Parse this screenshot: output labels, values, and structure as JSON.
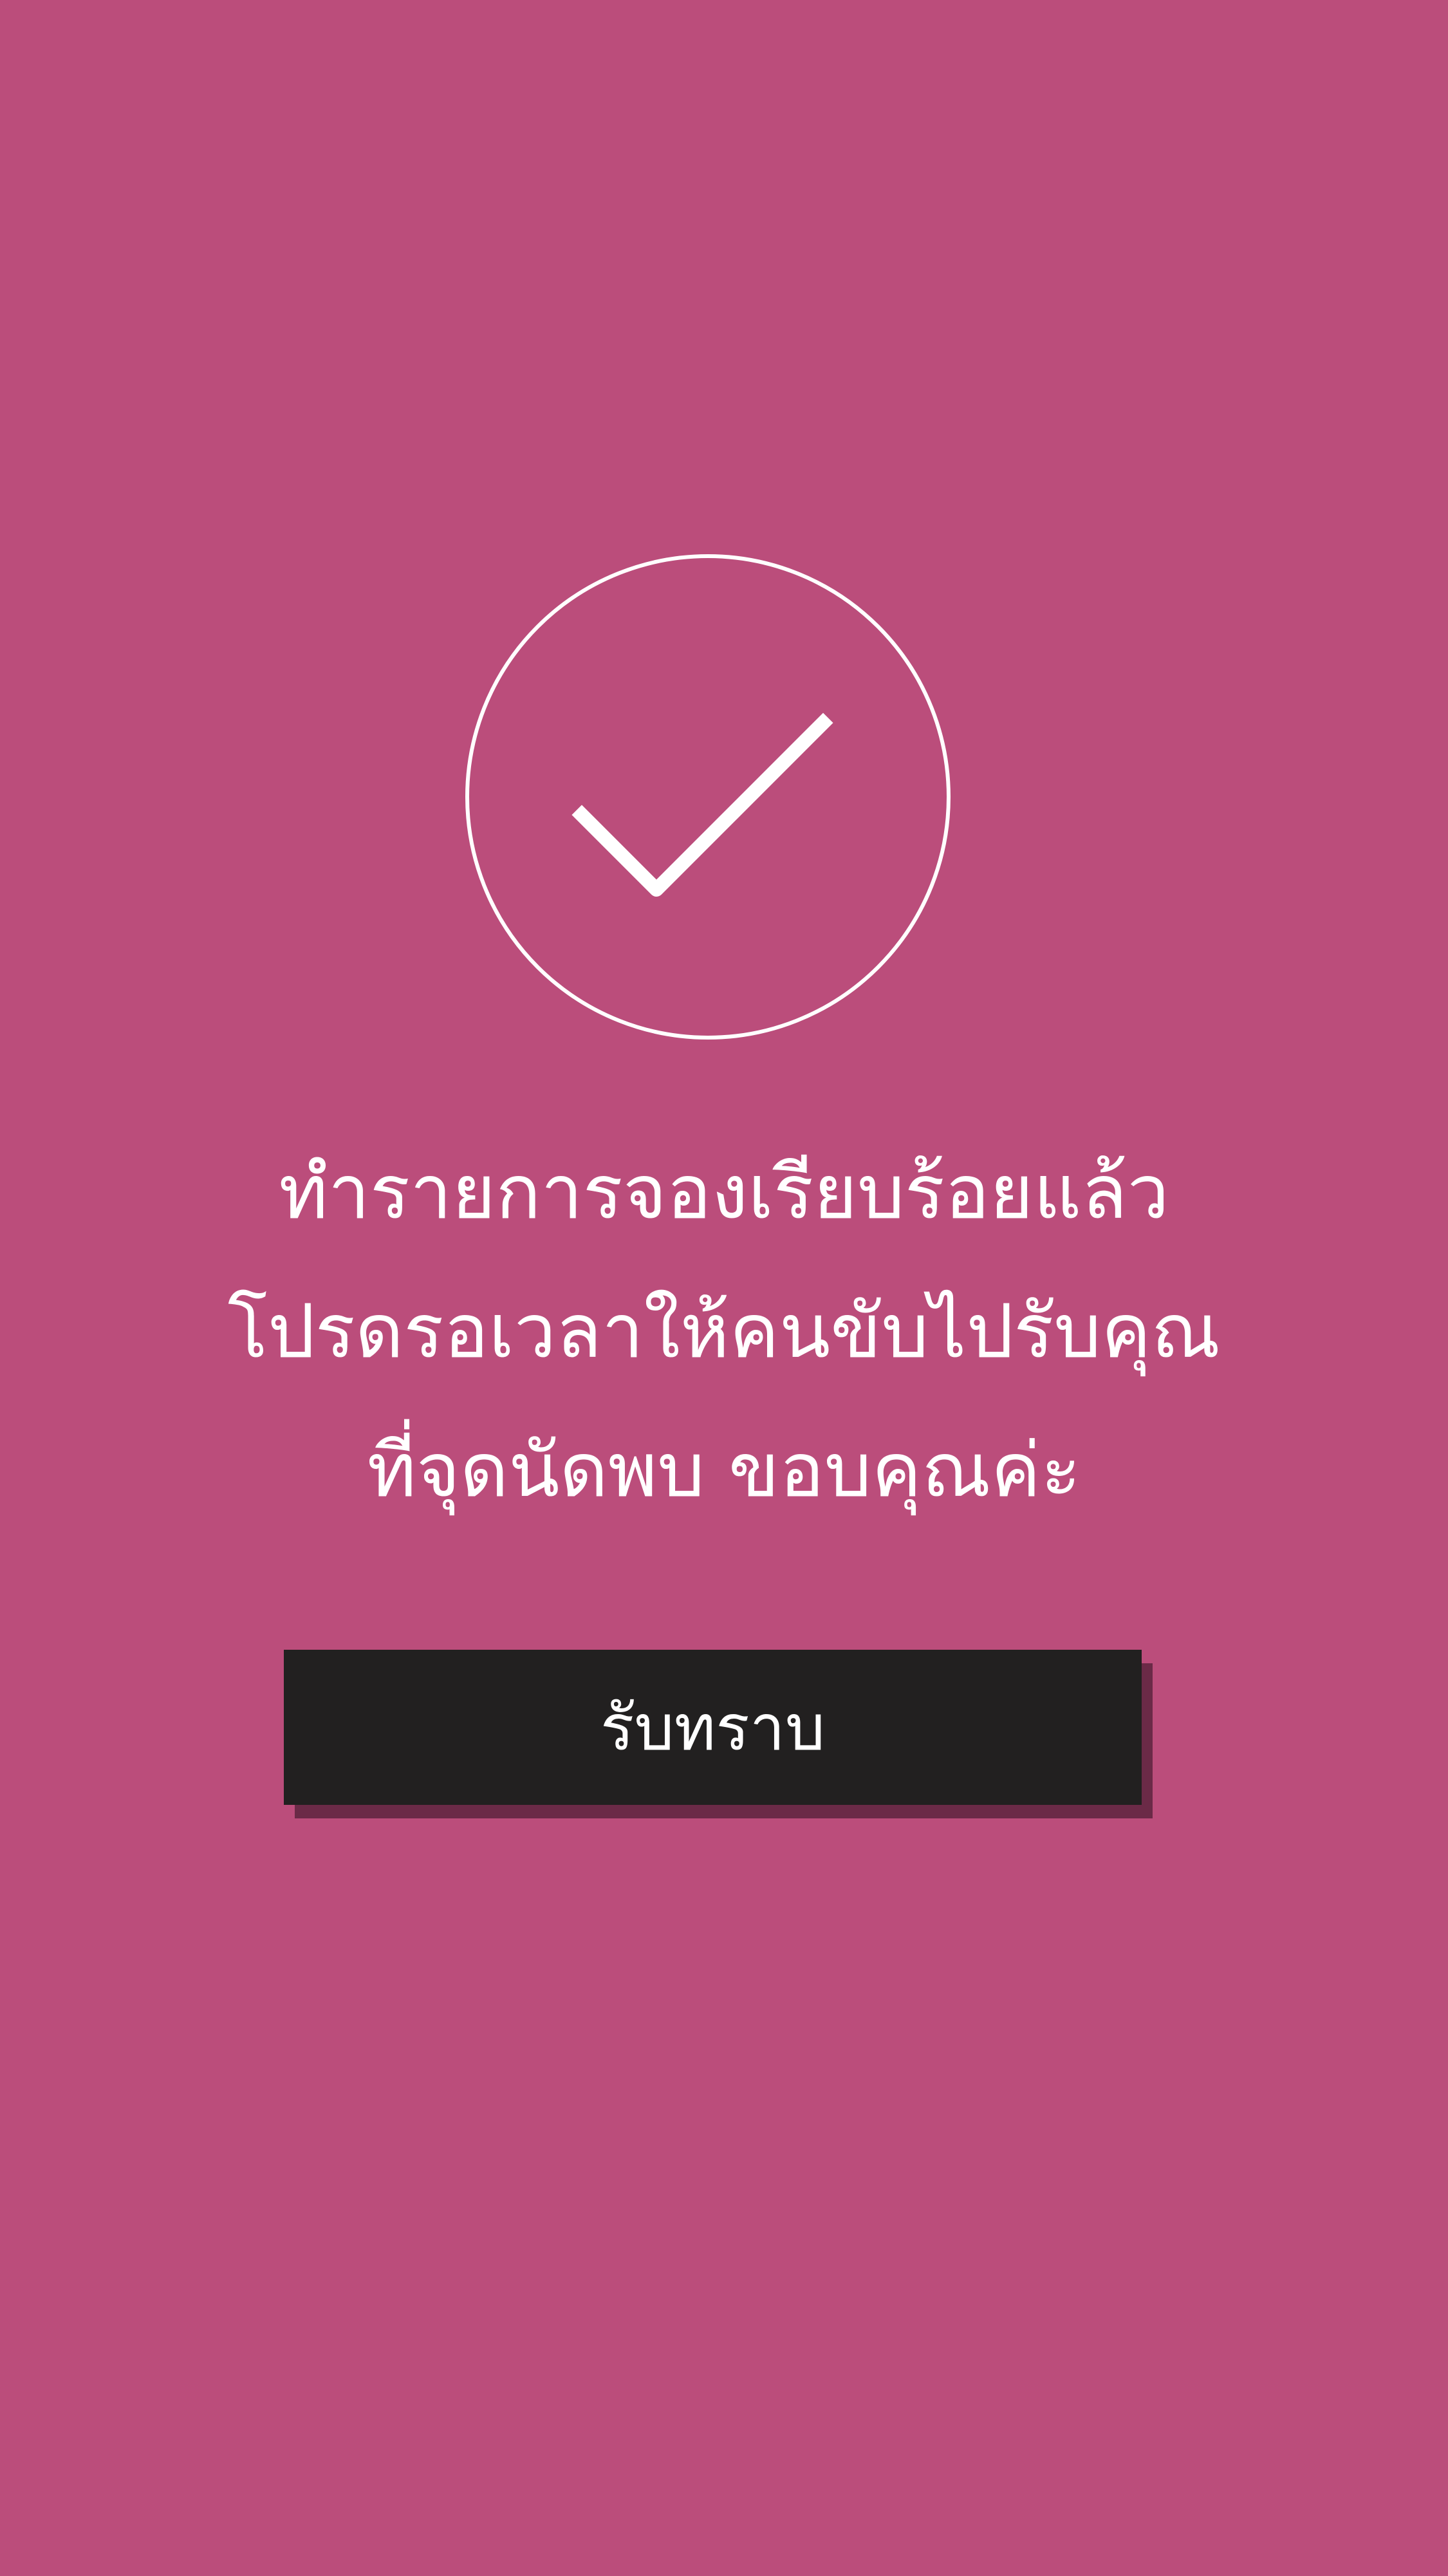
{
  "icons": {
    "success": "check-circle-icon"
  },
  "colors": {
    "background": "#bb4d7b",
    "button": "#222020",
    "button_shadow": "#6b2a47",
    "text": "#ffffff"
  },
  "message": {
    "line1": "ทำรายการจองเรียบร้อยแล้ว",
    "line2": "โปรดรอเวลาให้คนขับไปรับคุณ",
    "line3": "ที่จุดนัดพบ  ขอบคุณค่ะ"
  },
  "actions": {
    "acknowledge_label": "รับทราบ"
  }
}
